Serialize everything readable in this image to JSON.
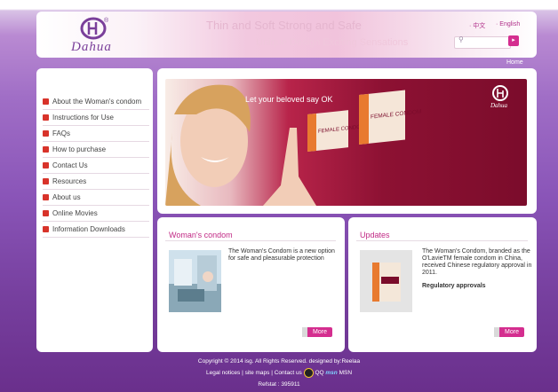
{
  "brand": {
    "name": "Dahua",
    "registered": "®"
  },
  "header": {
    "slogan_line1": "Thin and Soft Strong and Safe",
    "slogan_line2": "Unique Design  Exciting Sensations",
    "lang_cn": "中文",
    "lang_en": "English",
    "search": {
      "placeholder": "",
      "button": "▸"
    },
    "home": "Home"
  },
  "sidebar": {
    "items": [
      {
        "label": "About the Woman's condom"
      },
      {
        "label": "Instructions for Use"
      },
      {
        "label": "FAQs"
      },
      {
        "label": "How to purchase"
      },
      {
        "label": "Contact Us"
      },
      {
        "label": "Resources"
      },
      {
        "label": "About us"
      },
      {
        "label": "Online Movies"
      },
      {
        "label": "Information Downloads"
      }
    ]
  },
  "banner": {
    "headline": "Let your beloved say OK",
    "box_label_1": "FEMALE CONDOM",
    "box_label_2": "FEMALE CONDOM",
    "logo_text": "Dahua"
  },
  "womans_condom": {
    "title": "Woman's condom",
    "text": "The Woman's Condom is a new option for safe and pleasurable protection",
    "more": "More"
  },
  "updates": {
    "title": "Updates",
    "text": "The Woman's Condom, branded as the O'LavieTM female condom in China, received Chinese regulatory approval in 2011.",
    "link": "Regulatory approvals",
    "more": "More"
  },
  "footer": {
    "copyright": "Copyright © 2014 isg. All Rights Reserved. designed by:Reelaa",
    "legal": "Legal notices",
    "sitemap": "site maps",
    "contact": "Contact us",
    "qq": "QQ",
    "msn_logo": "msn",
    "msn": "MSN",
    "refstat": "Refstat : 395911"
  },
  "colors": {
    "accent": "#d42e8f",
    "bullet": "#d8332a",
    "title": "#c12a85"
  }
}
